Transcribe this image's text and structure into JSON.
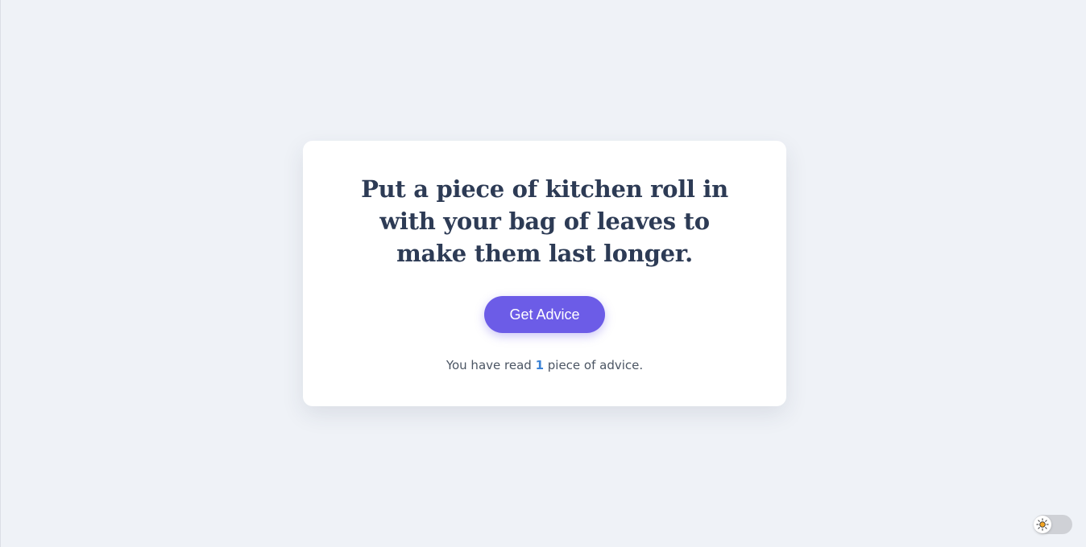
{
  "advice": {
    "text": "Put a piece of kitchen roll in with your bag of leaves to make them last longer."
  },
  "button": {
    "label": "Get Advice"
  },
  "counter": {
    "prefix": "You have read ",
    "count": "1",
    "suffix": " piece of advice."
  },
  "theme_toggle": {
    "icon": "sun-icon",
    "state": "light"
  },
  "colors": {
    "accent": "#6c5ce7",
    "count_highlight": "#3b82d6",
    "heading": "#2d3b55",
    "background": "#eff2f7",
    "sun": "#f5a623"
  }
}
